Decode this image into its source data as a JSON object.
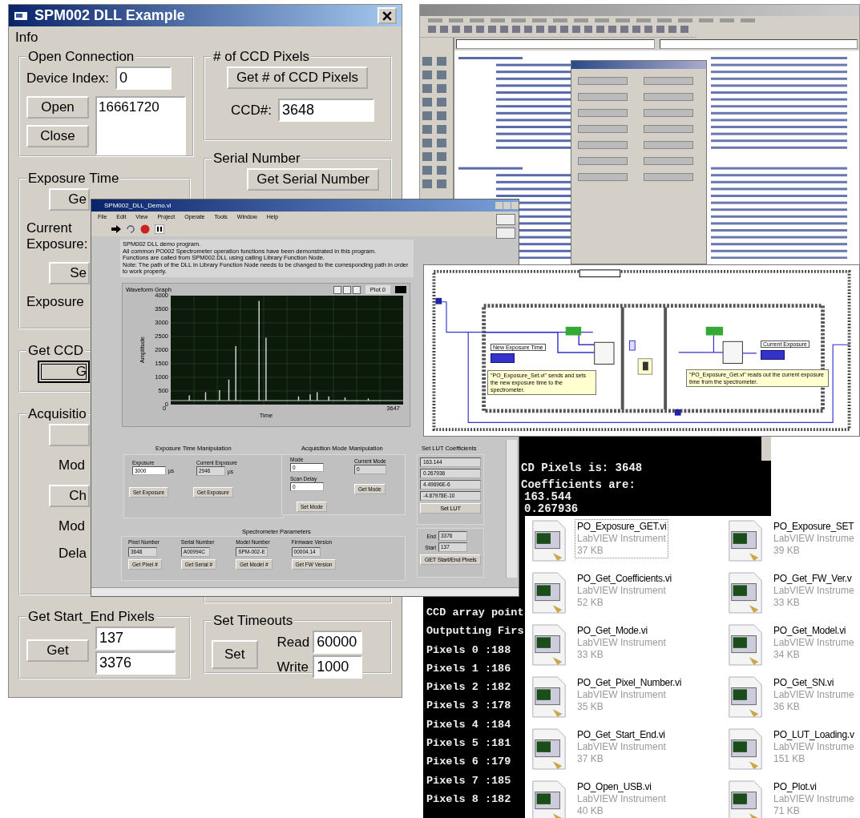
{
  "vb_dialog": {
    "title": "SPM002 DLL Example",
    "menu": [
      "Info"
    ],
    "open_connection": {
      "legend": "Open Connection",
      "device_index_label": "Device Index:",
      "device_index": "0",
      "open_button": "Open",
      "close_button": "Close",
      "handles": [
        "16661720"
      ]
    },
    "ccd_pixels": {
      "legend": "# of CCD Pixels",
      "button": "Get # of CCD Pixels",
      "label": "CCD#:",
      "value": "3648"
    },
    "serial_number": {
      "legend": "Serial Number",
      "button": "Get Serial Number"
    },
    "exposure_time": {
      "legend": "Exposure Time",
      "button_1": "Ge",
      "current_label": "Current Exposure:",
      "button_2": "Se",
      "exposure_label": "Exposure"
    },
    "get_ccd": {
      "legend": "Get CCD",
      "button": "G"
    },
    "acquisition": {
      "legend": "Acquisitio",
      "label_1": "Mod",
      "button": "Ch",
      "label_2": "Mod",
      "label_3": "Dela"
    },
    "start_end": {
      "legend": "Get Start_End Pixels",
      "button": "Get",
      "start": "137",
      "end": "3376"
    },
    "timeouts": {
      "legend": "Set Timeouts",
      "button": "Set",
      "read_label": "Read",
      "read": "60000",
      "write_label": "Write",
      "write": "1000"
    }
  },
  "labview_panel": {
    "title": "SPM002_DLL_Demo.vi",
    "menu": [
      "File",
      "Edit",
      "View",
      "Project",
      "Operate",
      "Tools",
      "Window",
      "Help"
    ],
    "description": [
      "SPM002 DLL demo program.",
      "All common PO002 Spectrometer operation functions have been demonstrated in this program.",
      "Functions are called from SPM002.DLL using calling Library Function Node.",
      "Note: The path of the DLL in Library Function Node needs to be changed to the corresponding path in order to work properly."
    ],
    "graph": {
      "title": "Waveform Graph",
      "legend": "Plot 0",
      "ylabel": "Amplitude",
      "xlabel": "Time",
      "yticks": [
        "4000",
        "3500",
        "3000",
        "2500",
        "2000",
        "1500",
        "1000",
        "500",
        "0"
      ],
      "xticks": [
        "0",
        "3647"
      ]
    },
    "exposure_section": {
      "title": "Exposure Time Manipulation",
      "exposure_label": "Exposure",
      "exposure": "3000",
      "unit_1": "µs",
      "current_label": "Current Exposure",
      "current": "2946",
      "unit_2": "µs",
      "button_1": "Set Exposure",
      "button_2": "Get Exposure"
    },
    "mode_section": {
      "title": "Acquisition Mode Manipulation",
      "mode_label": "Mode",
      "mode": "0",
      "delay_label": "Scan Delay",
      "delay": "0",
      "set_button": "Set Mode",
      "current_label": "Current Mode",
      "current": "0",
      "get_button": "Get Mode"
    },
    "lut_section": {
      "title": "Set LUT Coefficients",
      "values": [
        "163.144",
        "0.267936",
        "4.49696E-6",
        "-4.87978E-10"
      ],
      "button": "Set LUT"
    },
    "spectrometer_section": {
      "title": "Spectrometer Parameters",
      "fields": [
        {
          "label": "Pixel Number",
          "value": "3648",
          "button": "Get Pixel #"
        },
        {
          "label": "Serial Number",
          "value": "A00994C",
          "button": "Get Serial #"
        },
        {
          "label": "Model Number",
          "value": "SPM-002-E",
          "button": "Get Model #"
        },
        {
          "label": "Firmware Version",
          "value": "00004.14",
          "button": "Get FW Version"
        }
      ]
    },
    "pixels_section": {
      "end_label": "End",
      "end": "3376",
      "start_label": "Start",
      "start": "137",
      "button": "GET Start/End Pixels"
    }
  },
  "block_diagram": {
    "control_label": "New Exposure Time",
    "indicator_label": "Current Exposure",
    "comments": [
      "\"PO_Exposure_Set.vi\" sends and sets the new exposure time to the spectrometer.",
      "\"PO_Exposure_Get.vi\" reads out the current exposure time from the spectrometer."
    ]
  },
  "console": {
    "upper_lines": [
      "CD Pixels is: 3648",
      "Coefficients are:",
      "163.544",
      "0.267936"
    ],
    "lower_lines": [
      "CCD array point",
      "Outputting Firs",
      "Pixels 0 :188",
      "Pixels 1 :186",
      "Pixels 2 :182",
      "Pixels 3 :178",
      "Pixels 4 :184",
      "Pixels 5 :181",
      "Pixels 6 :179",
      "Pixels 7 :185",
      "Pixels 8 :182"
    ]
  },
  "files": [
    {
      "name": "PO_Exposure_GET.vi",
      "type": "LabVIEW Instrument",
      "size": "37 KB",
      "selected": true
    },
    {
      "name": "PO_Exposure_SET",
      "type": "LabVIEW Instrume",
      "size": "39 KB",
      "selected": false
    },
    {
      "name": "PO_Get_Coefficients.vi",
      "type": "LabVIEW Instrument",
      "size": "52 KB",
      "selected": false
    },
    {
      "name": "PO_Get_FW_Ver.v",
      "type": "LabVIEW Instrume",
      "size": "33 KB",
      "selected": false
    },
    {
      "name": "PO_Get_Mode.vi",
      "type": "LabVIEW Instrument",
      "size": "33 KB",
      "selected": false
    },
    {
      "name": "PO_Get_Model.vi",
      "type": "LabVIEW Instrume",
      "size": "34 KB",
      "selected": false
    },
    {
      "name": "PO_Get_Pixel_Number.vi",
      "type": "LabVIEW Instrument",
      "size": "35 KB",
      "selected": false
    },
    {
      "name": "PO_Get_SN.vi",
      "type": "LabVIEW Instrume",
      "size": "36 KB",
      "selected": false
    },
    {
      "name": "PO_Get_Start_End.vi",
      "type": "LabVIEW Instrument",
      "size": "37 KB",
      "selected": false
    },
    {
      "name": "PO_LUT_Loading.v",
      "type": "LabVIEW Instrume",
      "size": "151 KB",
      "selected": false
    },
    {
      "name": "PO_Open_USB.vi",
      "type": "LabVIEW Instrument",
      "size": "40 KB",
      "selected": false
    },
    {
      "name": "PO_Plot.vi",
      "type": "LabVIEW Instrume",
      "size": "71 KB",
      "selected": false
    }
  ]
}
